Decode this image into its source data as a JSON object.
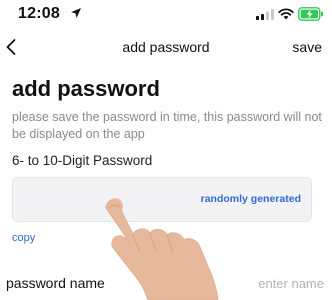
{
  "status_bar": {
    "time": "12:08",
    "icons": [
      "location-arrow-icon",
      "cellular-signal-icon",
      "wifi-icon",
      "battery-charging-icon"
    ],
    "battery_color": "#34c759"
  },
  "nav": {
    "back_icon": "chevron-left-icon",
    "title": "add password",
    "save_label": "save"
  },
  "page": {
    "heading": "add password",
    "notice": "please save the password in time, this password will not be displayed on the app"
  },
  "password_field": {
    "label": "6- to 10-Digit Password",
    "value": "",
    "generate_label": "randomly generated",
    "copy_label": "copy"
  },
  "name_field": {
    "label": "password name",
    "placeholder": "enter name",
    "value": ""
  },
  "overlay": {
    "icon": "tap-hand-pointer-icon"
  },
  "colors": {
    "accent": "#2f6bd6",
    "muted_text": "#8a8a8a",
    "field_bg": "#f3f3f5",
    "placeholder": "#b3b3b3"
  }
}
